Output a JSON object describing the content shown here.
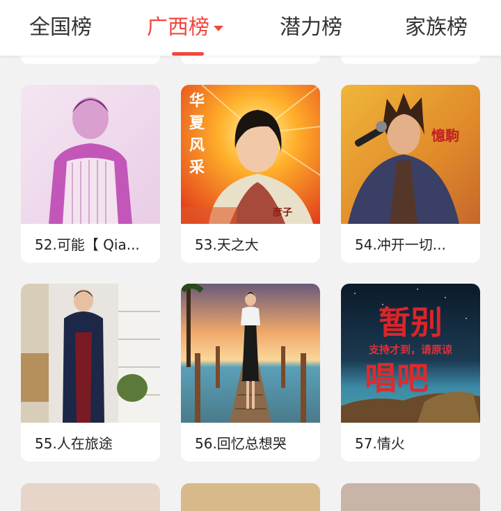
{
  "tabs": [
    {
      "label": "全国榜",
      "active": false
    },
    {
      "label": "广西榜",
      "active": true
    },
    {
      "label": "潜力榜",
      "active": false
    },
    {
      "label": "家族榜",
      "active": false
    }
  ],
  "accent_color": "#f0473f",
  "cards": [
    {
      "caption": "52.可能【 Qia...",
      "thumb_text": ""
    },
    {
      "caption": "53.天之大",
      "thumb_text": "华夏风采",
      "thumb_sub": "彦子"
    },
    {
      "caption": "54.冲开一切...",
      "thumb_text": "憶駒"
    },
    {
      "caption": "55.人在旅途",
      "thumb_text": ""
    },
    {
      "caption": "56.回忆总想哭",
      "thumb_text": ""
    },
    {
      "caption": "57.情火",
      "thumb_text": "暂别",
      "thumb_sub": "支持才到，请原谅",
      "thumb_text2": "唱吧"
    }
  ]
}
